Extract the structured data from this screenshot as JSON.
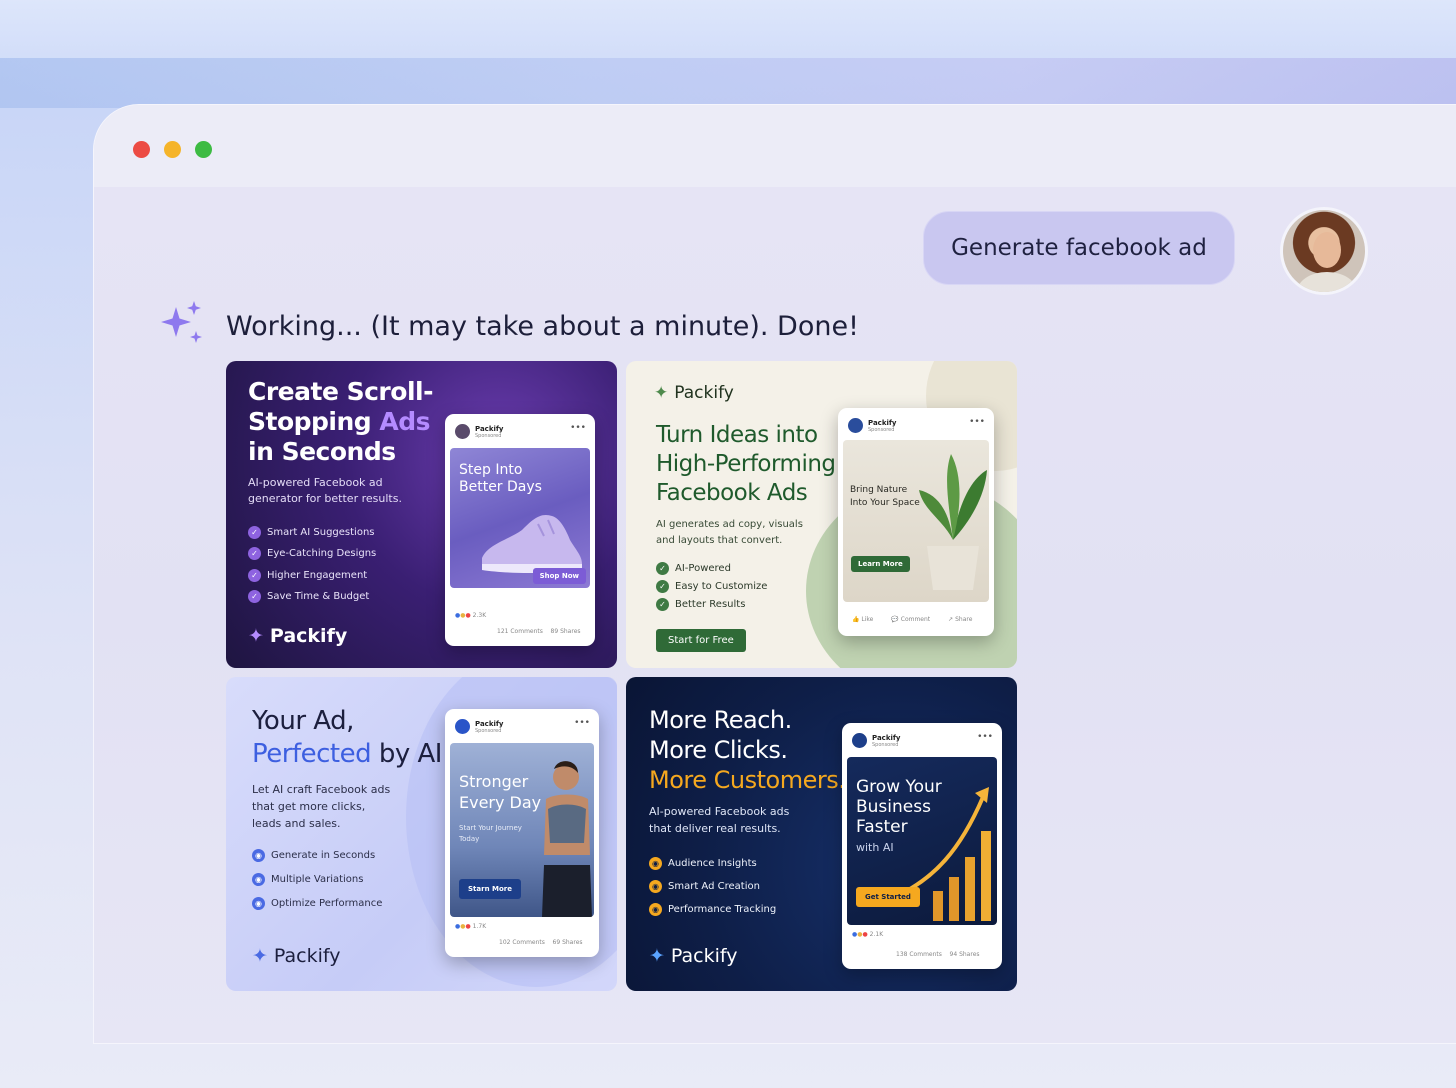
{
  "user_prompt": "Generate facebook ad",
  "status_text": "Working... (It may take about a minute). Done!",
  "colors": {
    "accent": "#8e79ee",
    "bubble": "#c9c7f0"
  },
  "ads": [
    {
      "headline_1": "Create Scroll-",
      "headline_2": "Stopping ",
      "headline_accent": "Ads",
      "headline_3": "in Seconds",
      "subtext_1": "AI-powered Facebook ad",
      "subtext_2": "generator for better results.",
      "features": [
        "Smart AI Suggestions",
        "Eye-Catching Designs",
        "Higher Engagement",
        "Save Time & Budget"
      ],
      "brand": "Packify",
      "post": {
        "page": "Packify",
        "sponsored": "Sponsored",
        "image_text_1": "Step Into",
        "image_text_2": "Better Days",
        "cta": "Shop Now",
        "reactions": "2.3K",
        "comments": "121 Comments",
        "shares": "89 Shares"
      }
    },
    {
      "brand": "Packify",
      "headline_1": "Turn Ideas into",
      "headline_2": "High-Performing",
      "headline_3": "Facebook Ads",
      "subtext_1": "AI generates ad copy, visuals",
      "subtext_2": "and layouts that convert.",
      "features": [
        "AI-Powered",
        "Easy to Customize",
        "Better Results"
      ],
      "button": "Start for Free",
      "post": {
        "page": "Packify",
        "sponsored": "Sponsored",
        "image_text_1": "Bring Nature",
        "image_text_2": "Into Your Space",
        "cta": "Learn More",
        "like": "Like",
        "comment": "Comment",
        "share": "Share"
      }
    },
    {
      "headline_1": "Your Ad,",
      "headline_accent": "Perfected",
      "headline_2": " by AI",
      "subtext_1": "Let AI craft Facebook ads",
      "subtext_2": "that get more clicks,",
      "subtext_3": "leads and sales.",
      "features": [
        "Generate in Seconds",
        "Multiple Variations",
        "Optimize Performance"
      ],
      "brand": "Packify",
      "post": {
        "page": "Packify",
        "sponsored": "Sponsored",
        "image_text_1": "Stronger",
        "image_text_2": "Every Day",
        "image_sub_1": "Start Your Journey",
        "image_sub_2": "Today",
        "cta": "Starn More",
        "reactions": "1.7K",
        "comments": "102 Comments",
        "shares": "69 Shares"
      }
    },
    {
      "headline_1": "More Reach.",
      "headline_2": "More Clicks.",
      "headline_accent": "More Customers.",
      "subtext_1": "AI-powered Facebook ads",
      "subtext_2": "that deliver real results.",
      "features": [
        "Audience Insights",
        "Smart Ad Creation",
        "Performance Tracking"
      ],
      "brand": "Packify",
      "post": {
        "page": "Packify",
        "sponsored": "Sponsored",
        "image_text_1": "Grow Your",
        "image_text_2": "Business",
        "image_text_3": "Faster",
        "image_sub_1": "with AI",
        "cta": "Get Started",
        "reactions": "2.1K",
        "comments": "138 Comments",
        "shares": "94 Shares"
      }
    }
  ]
}
